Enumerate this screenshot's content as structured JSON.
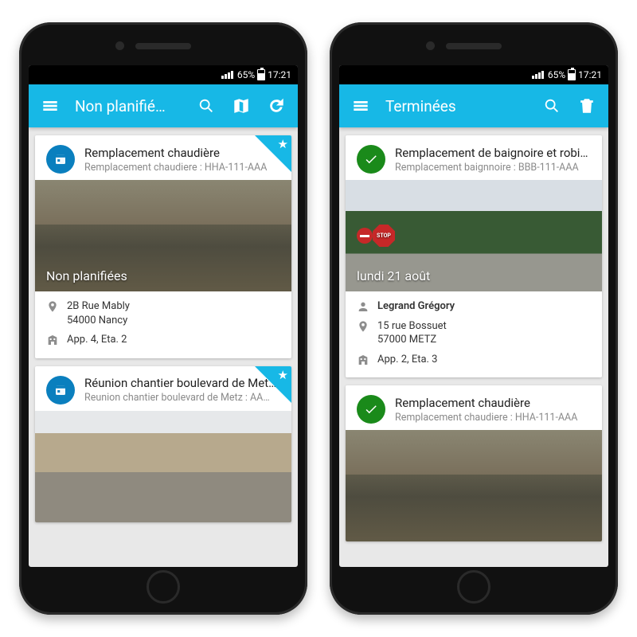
{
  "status": {
    "battery": "65%",
    "time": "17:21"
  },
  "left": {
    "title": "Non planifié…",
    "cards": [
      {
        "title": "Remplacement chaudière",
        "subtitle": "Remplacement chaudiere : HHA-111-AAA",
        "overlay": "Non planifiées",
        "addr1": "2B Rue Mably",
        "addr2": "54000 Nancy",
        "floor": "App. 4, Eta. 2"
      },
      {
        "title": "Réunion chantier boulevard de Met…",
        "subtitle": "Reunion chantier boulevard de Metz : AA…"
      }
    ]
  },
  "right": {
    "title": "Terminées",
    "cards": [
      {
        "title": "Remplacement de baignoire et robin…",
        "subtitle": "Remplacement baignnoire : BBB-111-AAA",
        "overlay": "lundi 21 août",
        "person": "Legrand Grégory",
        "addr1": "15 rue Bossuet",
        "addr2": "57000 METZ",
        "floor": "App. 2, Eta. 3"
      },
      {
        "title": "Remplacement chaudière",
        "subtitle": "Remplacement chaudiere : HHA-111-AAA"
      }
    ]
  }
}
